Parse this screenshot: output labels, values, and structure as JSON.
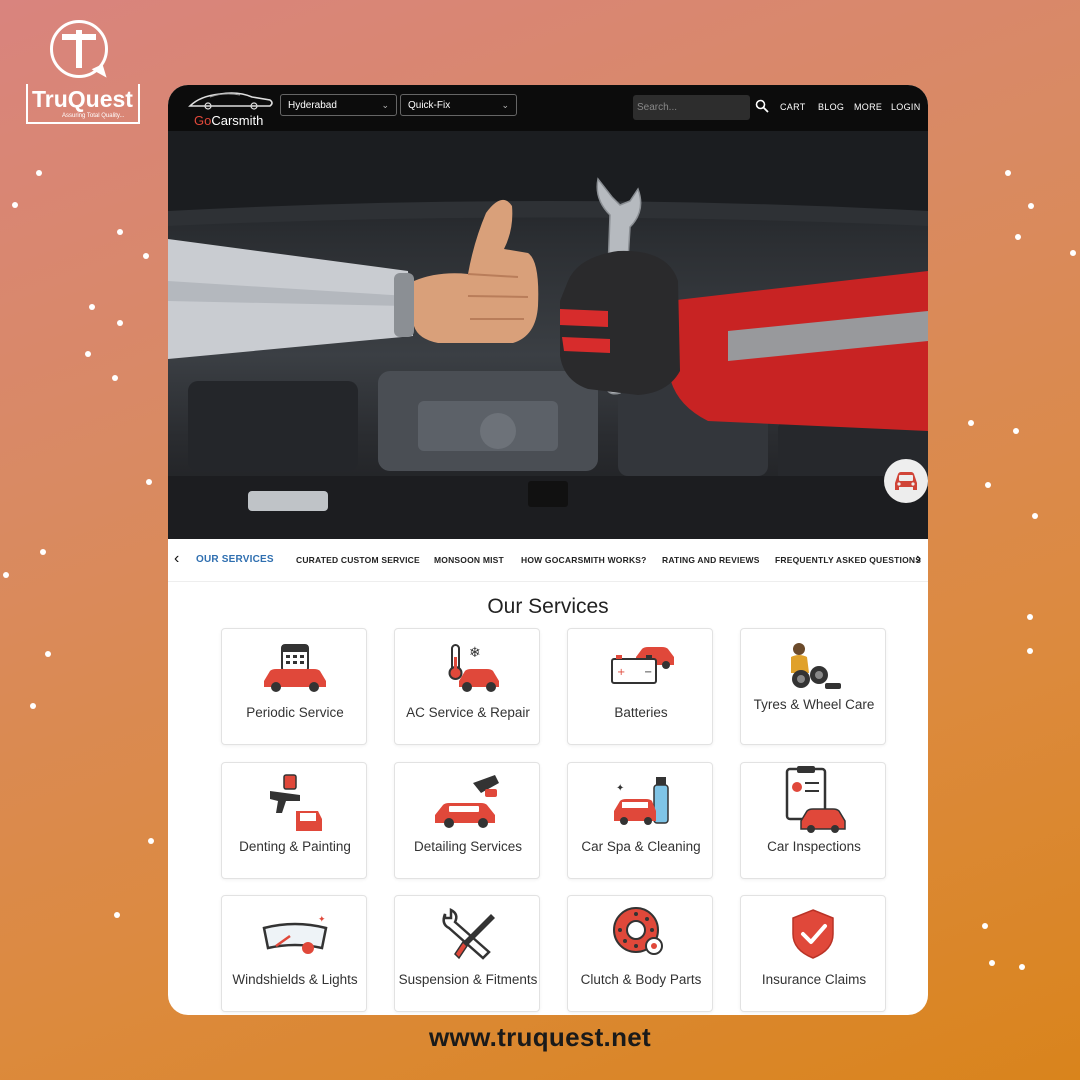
{
  "overlay": {
    "logo_name": "TruQuest",
    "logo_tagline": "Assuring Total Quality...",
    "website": "www.truquest.net"
  },
  "header": {
    "brand": "GoCarsmith",
    "city_select": "Hyderabad",
    "service_select": "Quick-Fix",
    "search_placeholder": "Search...",
    "nav": [
      "CART",
      "BLOG",
      "MORE",
      "LOGIN"
    ]
  },
  "tabs": [
    "OUR SERVICES",
    "CURATED CUSTOM SERVICE",
    "MONSOON MIST",
    "HOW GOCARSMITH WORKS?",
    "RATING AND REVIEWS",
    "FREQUENTLY ASKED QUESTIONS"
  ],
  "services": {
    "title": "Our Services",
    "items": [
      {
        "label": "Periodic Service",
        "icon": "calendar-car-icon"
      },
      {
        "label": "AC Service & Repair",
        "icon": "thermometer-car-icon"
      },
      {
        "label": "Batteries",
        "icon": "battery-car-icon"
      },
      {
        "label": "Tyres & Wheel Care",
        "icon": "tyre-mechanic-icon"
      },
      {
        "label": "Denting & Painting",
        "icon": "spray-gun-door-icon"
      },
      {
        "label": "Detailing Services",
        "icon": "polisher-car-icon"
      },
      {
        "label": "Car Spa & Cleaning",
        "icon": "spray-bottle-car-icon"
      },
      {
        "label": "Car Inspections",
        "icon": "clipboard-car-icon"
      },
      {
        "label": "Windshields & Lights",
        "icon": "windshield-icon"
      },
      {
        "label": "Suspension & Fitments",
        "icon": "wrench-screwdriver-icon"
      },
      {
        "label": "Clutch & Body Parts",
        "icon": "clutch-plate-icon"
      },
      {
        "label": "Insurance Claims",
        "icon": "shield-check-icon"
      }
    ]
  },
  "colors": {
    "brand_red": "#e0483a",
    "active_tab": "#2f6fb0",
    "topbar": "#0c0c0c"
  }
}
